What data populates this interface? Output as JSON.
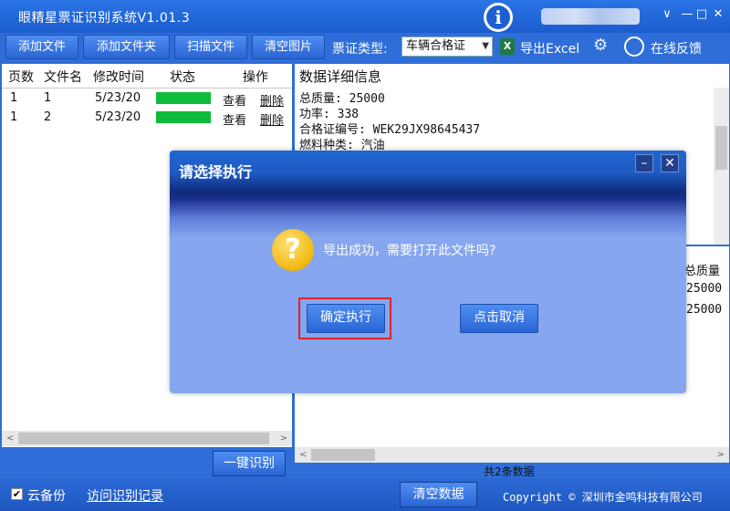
{
  "app": {
    "title": "眼精星票证识别系统V1.01.3"
  },
  "toolbar": {
    "add_file": "添加文件",
    "add_folder": "添加文件夹",
    "scan_file": "扫描文件",
    "clear_images": "清空图片",
    "ticket_type_label": "票证类型:",
    "ticket_type_value": "车辆合格证",
    "export_excel": "导出Excel",
    "online_feedback": "在线反馈",
    "icons": [
      "excel-icon",
      "gear-icon",
      "chat-icon"
    ]
  },
  "file_table": {
    "headers": [
      "页数",
      "文件名",
      "修改时间",
      "状态",
      "操作"
    ],
    "rows": [
      {
        "page": "1",
        "name": "1",
        "modified": "5/23/20",
        "status_progress": 1.0,
        "view": "查看",
        "delete": "删除"
      },
      {
        "page": "1",
        "name": "2",
        "modified": "5/23/20",
        "status_progress": 1.0,
        "view": "查看",
        "delete": "删除"
      }
    ]
  },
  "detail": {
    "title": "数据详细信息",
    "lines": [
      "总质量: 25000",
      "功率: 338",
      "合格证编号: WEK29JX98645437",
      "燃料种类: 汽油"
    ]
  },
  "result_table": {
    "header": "总质量",
    "values": [
      "25000",
      "25000"
    ]
  },
  "buttons": {
    "recognize": "一键识别",
    "clear_data": "清空数据"
  },
  "record_count": "共2条数据",
  "status": {
    "cloud_backup": "云备份",
    "cloud_checked": true,
    "history_link": "访问识别记录",
    "copyright": "Copyright © 深圳市金鸣科技有限公司"
  },
  "dialog": {
    "title": "请选择执行",
    "message": "导出成功，需要打开此文件吗?",
    "confirm": "确定执行",
    "cancel": "点击取消"
  },
  "colors": {
    "accent": "#2f6ed8",
    "progress": "#0fbb3a",
    "highlight": "#e02424"
  }
}
